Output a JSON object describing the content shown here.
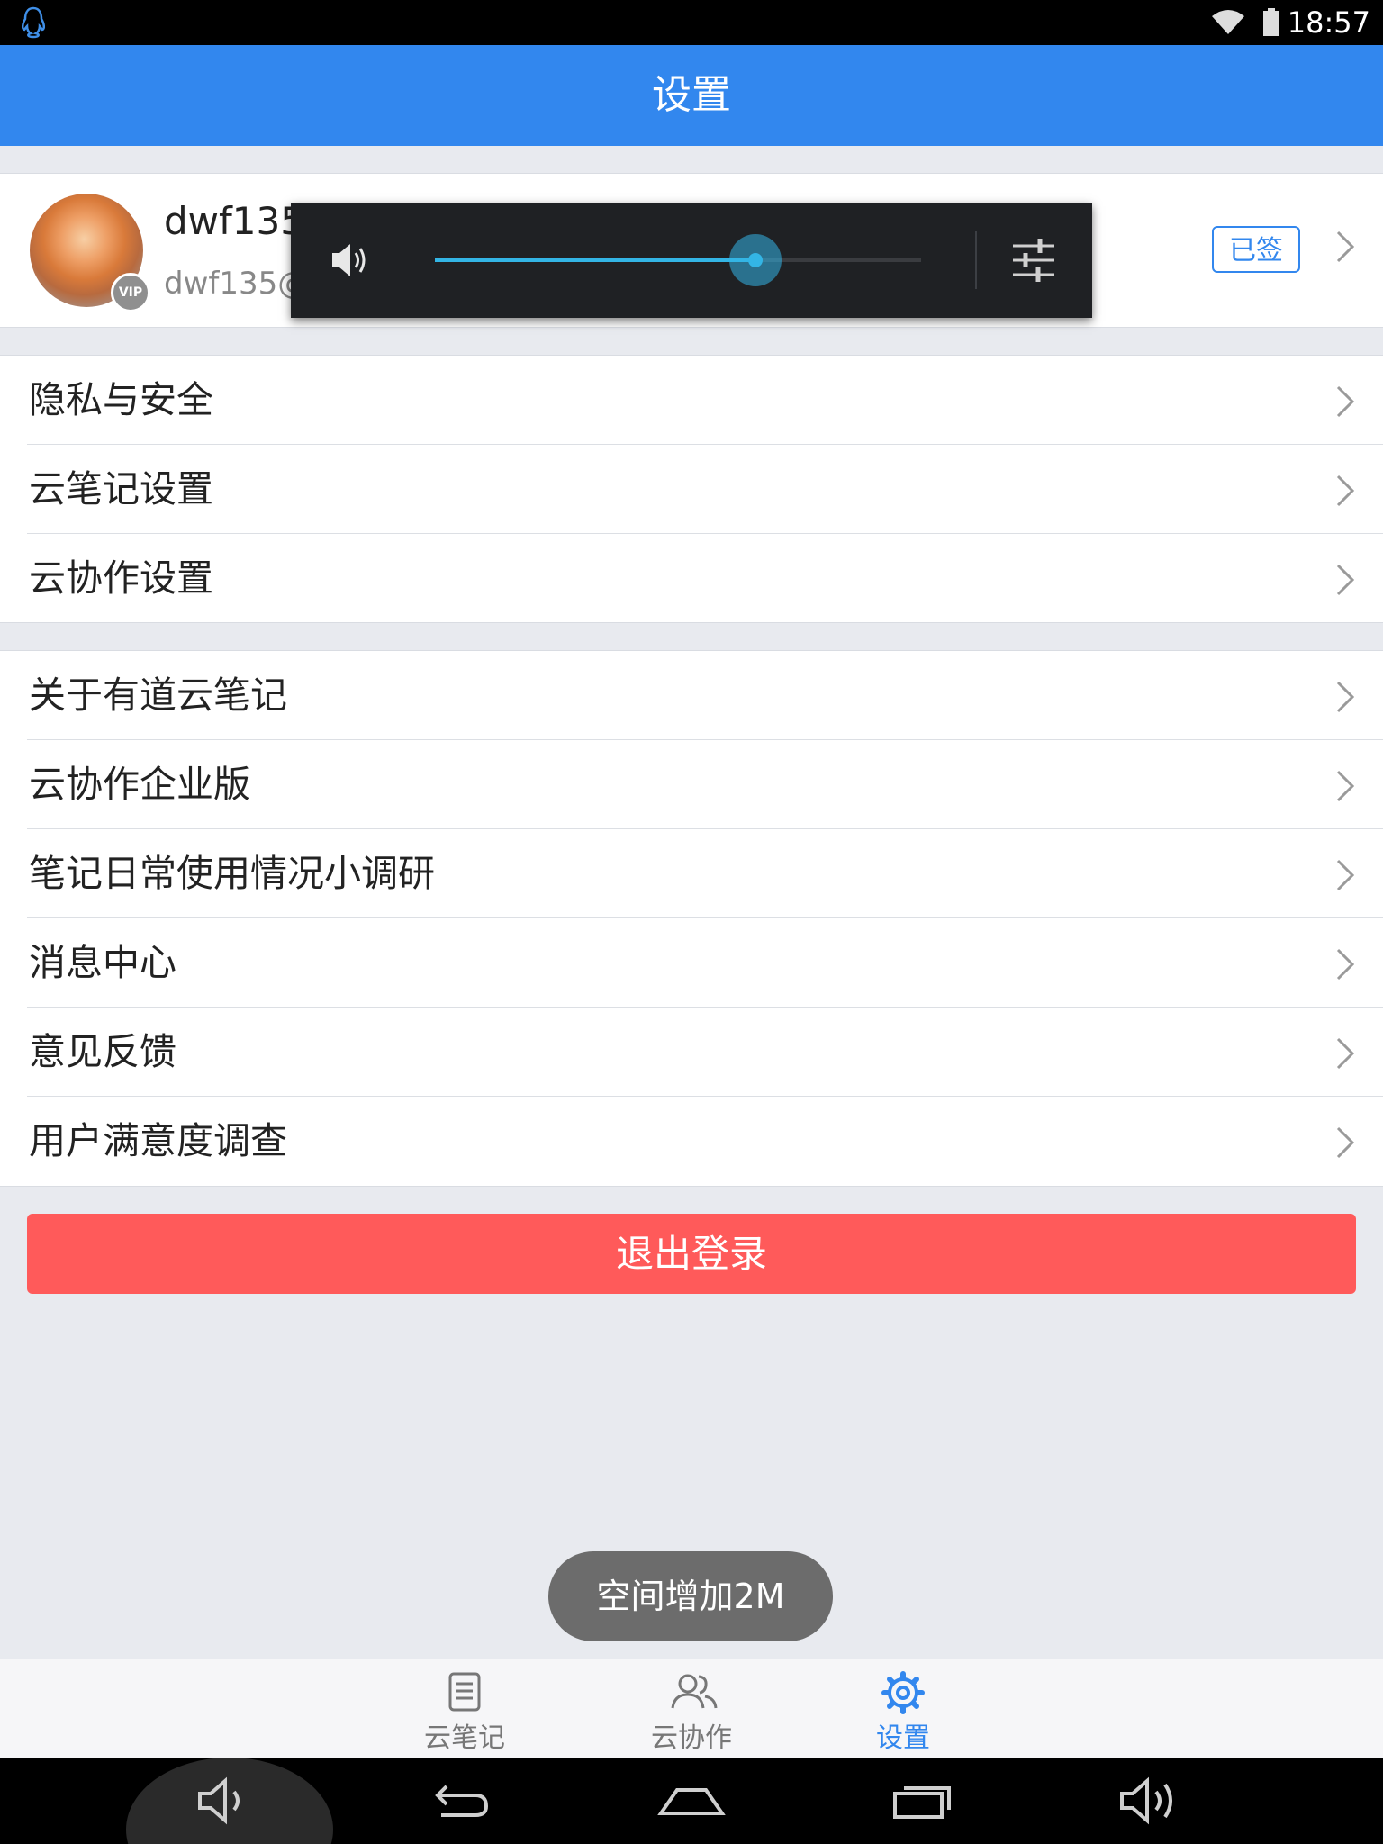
{
  "status_bar": {
    "time": "18:57",
    "icons": [
      "qq-icon",
      "wifi-icon",
      "battery-icon"
    ]
  },
  "header": {
    "title": "设置"
  },
  "profile": {
    "username": "dwf135",
    "email": "dwf135@",
    "vip_label": "VIP",
    "signin_label": "已签",
    "accent_color": "#3287ee"
  },
  "volume_overlay": {
    "level": 0.66,
    "icons": [
      "speaker-icon",
      "sliders-icon"
    ]
  },
  "menu_group_1": [
    {
      "label": "隐私与安全"
    },
    {
      "label": "云笔记设置"
    },
    {
      "label": "云协作设置"
    }
  ],
  "menu_group_2": [
    {
      "label": "关于有道云笔记"
    },
    {
      "label": "云协作企业版"
    },
    {
      "label": "笔记日常使用情况小调研"
    },
    {
      "label": "消息中心"
    },
    {
      "label": "意见反馈"
    },
    {
      "label": "用户满意度调查"
    }
  ],
  "logout": {
    "label": "退出登录",
    "color": "#ff5a5a"
  },
  "toast": {
    "text": "空间增加2M"
  },
  "tabs": [
    {
      "label": "云笔记",
      "icon": "note-icon",
      "active": false
    },
    {
      "label": "云协作",
      "icon": "people-icon",
      "active": false
    },
    {
      "label": "设置",
      "icon": "gear-icon",
      "active": true
    }
  ],
  "nav_bar": {
    "buttons": [
      "volume-down-icon",
      "back-icon",
      "home-icon",
      "recents-icon",
      "volume-up-icon"
    ]
  }
}
